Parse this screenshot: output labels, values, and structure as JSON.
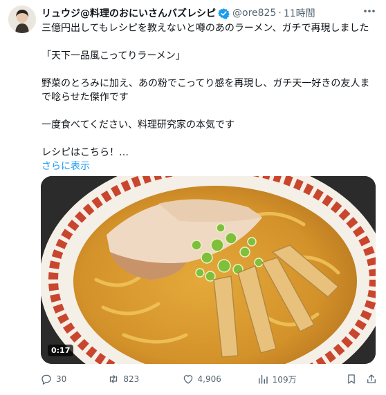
{
  "tweet": {
    "display_name": "リュウジ@料理のおにいさんバズレシピ",
    "handle": "@ore825",
    "separator": "·",
    "time": "11時間",
    "text_lines": [
      "三億円出してもレシピを教えないと噂のあのラーメン、ガチで再現しました",
      "「天下一品風こってりラーメン」",
      "野菜のとろみに加え、あの粉でこってり感を再現し、ガチ天一好きの友人まで唸らせた傑作です",
      "一度食べてください、料理研究家の本気です",
      "レシピはこちら！…"
    ],
    "show_more": "さらに表示"
  },
  "media": {
    "duration": "0:17"
  },
  "actions": {
    "replies": "30",
    "retweets": "823",
    "likes": "4,906",
    "views": "109万"
  },
  "colors": {
    "accent": "#1d9bf0",
    "muted": "#536471"
  }
}
